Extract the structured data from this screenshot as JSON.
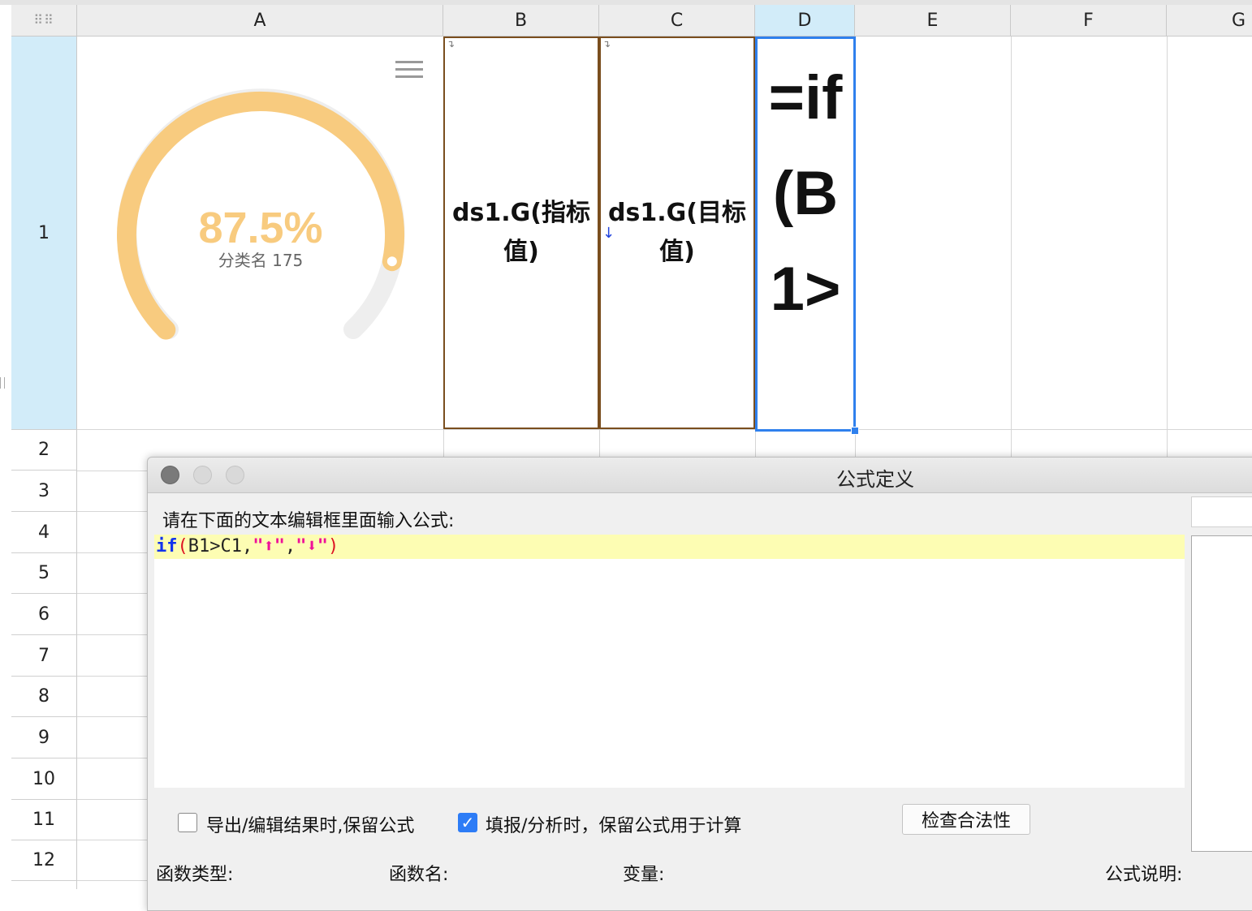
{
  "columns": [
    "A",
    "B",
    "C",
    "D",
    "E",
    "F",
    "G"
  ],
  "rows": [
    "1",
    "2",
    "3",
    "4",
    "5",
    "6",
    "7",
    "8",
    "9",
    "10",
    "11",
    "12"
  ],
  "selected_column": "D",
  "selected_row": "1",
  "cells": {
    "B1": "ds1.G(指标值)",
    "C1": "ds1.G(目标值)",
    "D1": "=if(B1>"
  },
  "gauge": {
    "value_text": "87.5%",
    "value_fraction": 0.875,
    "label": "分类名 175",
    "color": "#f8cb7f",
    "track_color": "#eeeeee",
    "menu_icon": "hamburger-menu-icon"
  },
  "dialog": {
    "title": "公式定义",
    "prompt": "请在下面的文本编辑框里面输入公式:",
    "formula": {
      "keyword": "if",
      "open": "(",
      "args": "B1>C1,",
      "str1": "\"⬆\"",
      "comma": ",",
      "str2": "\"⬇\"",
      "close": ")"
    },
    "checkbox_export": {
      "label": "导出/编辑结果时,保留公式",
      "checked": false
    },
    "checkbox_fill": {
      "label": "填报/分析时，保留公式用于计算",
      "checked": true
    },
    "check_button": "检查合法性",
    "bottom_labels": {
      "func_type": "函数类型:",
      "func_name": "函数名:",
      "variable": "变量:",
      "description": "公式说明:"
    }
  }
}
